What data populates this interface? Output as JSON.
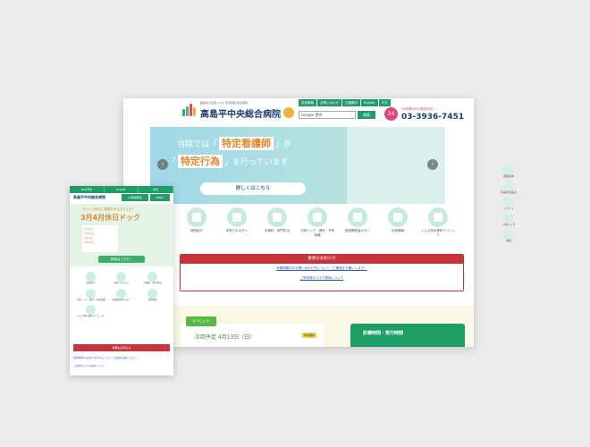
{
  "desktop": {
    "logo": {
      "subtitle": "医療法人社団イムス 東京葛飾 総合病院",
      "name": "高島平中央総合病院"
    },
    "top_nav": [
      "採用情報",
      "お問い合わせ",
      "交通案内",
      "English",
      "中文"
    ],
    "search": {
      "placeholder": "Google 提供",
      "button": "検索"
    },
    "phone": {
      "icon": "24",
      "caption": "24時間365日救急対応",
      "number": "03-3936-7451"
    },
    "hero": {
      "line1_pre": "当院では「",
      "line1_hl": "特定看護師",
      "line1_post": "」が",
      "line2_pre": "「",
      "line2_hl": "特定行為",
      "line2_post": "」を行っています",
      "button": "詳しくはこちら",
      "prev": "‹",
      "next": "›"
    },
    "categories": [
      "病院紹介",
      "来院される方へ",
      "診療科・部門担当",
      "人間ドック・健診・予防接種",
      "医療関係者の方へ",
      "採用情報",
      "イムス西台透析クリニック"
    ],
    "notice": {
      "title": "重要なお知らせ",
      "links": [
        "休業期間中のお問い合わせ先について（ご確認をお願いします）",
        "ご来院時のマスク着用について"
      ]
    },
    "side_fixed": [
      "健康案内",
      "外来担当医表",
      "イベント",
      "人間ドック",
      "採用"
    ],
    "event": {
      "tag": "イベント",
      "date": "次回予定 4月13日（日）",
      "badge": "参加無料"
    },
    "hours": {
      "title": "診療時間・受付時間"
    }
  },
  "mobile": {
    "top_bar": [
      "Web予約",
      "English",
      "中文"
    ],
    "logo": "高島平中央総合病院",
    "tel": "24時間救急",
    "menu": "MENU",
    "banner": {
      "sub": "ゆっくり休日に健康を考えませんか？",
      "title": "3月4月休日ドック",
      "card": [
        "3/8(土)",
        "3/22(土)",
        "4/5(土)",
        "4/19(土)"
      ],
      "button": "詳細はこちら！"
    },
    "categories": [
      "病院紹介",
      "来院される方へ",
      "診療科・部門担当",
      "人間ドック・健診・予防接種",
      "医療関係者の方へ",
      "採用情報",
      "イムス西台透析クリニック"
    ],
    "notice": {
      "title": "重要なお知らせ",
      "links": [
        "休業期間中のお問い合わせ先について（ご確認をお願いします）",
        "ご来院時のマスク着用について"
      ]
    }
  }
}
